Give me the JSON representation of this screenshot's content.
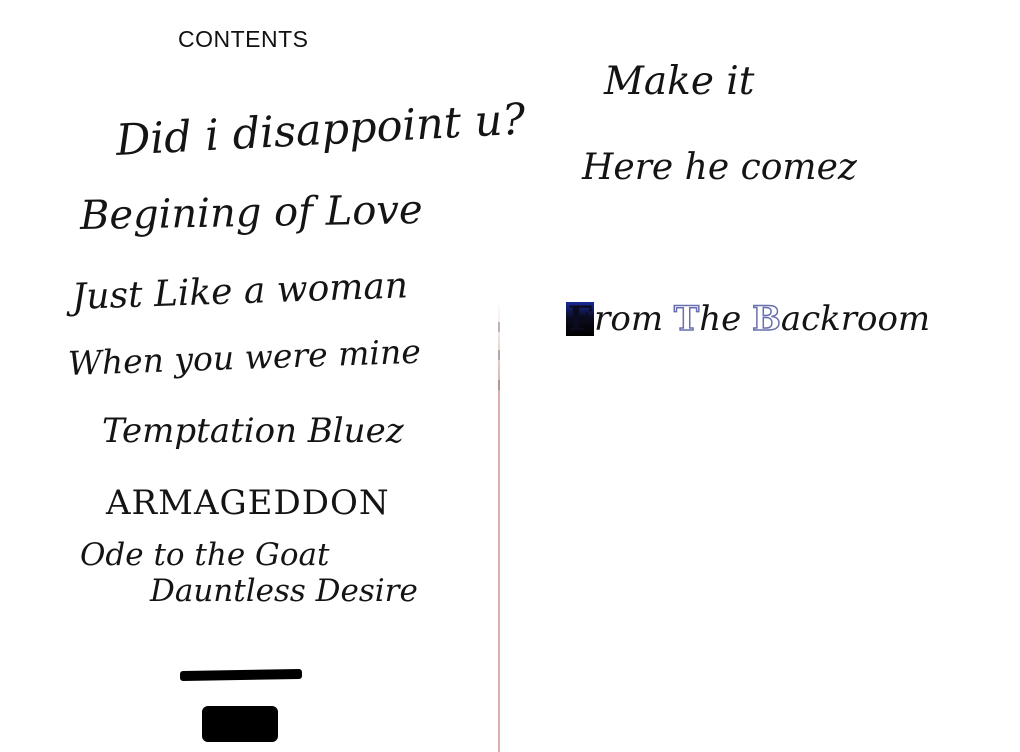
{
  "left_page": {
    "heading": "CONTENTS",
    "entries": [
      "Did i disappoint u?",
      "Begining of Love",
      "Just Like a woman",
      "When you were mine",
      "Temptation Bluez",
      "ARMAGEDDON",
      "Ode to the Goat",
      "Dauntless Desire"
    ]
  },
  "right_page": {
    "entries": [
      "Make it",
      "Here he comez"
    ],
    "styled_title": {
      "initial_1": "F",
      "rest_1": "rom",
      "initial_2": "T",
      "rest_2": "he",
      "initial_3": "B",
      "rest_3": "ackroom"
    }
  },
  "colors": {
    "paper": "#ffffff",
    "ink": "#141414",
    "accent_blue": "#1a2a9a",
    "outline_blue": "#6a6fb0",
    "gutter": "#be6e64"
  }
}
